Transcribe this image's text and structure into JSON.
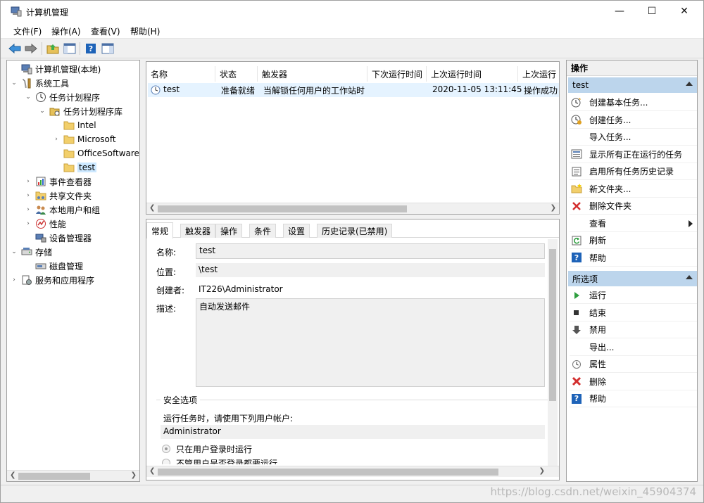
{
  "window": {
    "title": "计算机管理",
    "controls": {
      "minimize": "—",
      "maximize": "☐",
      "close": "✕"
    }
  },
  "menubar": [
    "文件(F)",
    "操作(A)",
    "查看(V)",
    "帮助(H)"
  ],
  "tree": [
    {
      "label": "计算机管理(本地)",
      "expander": "",
      "icon": "computer-management-icon"
    },
    {
      "label": "系统工具",
      "expander": "⌄",
      "icon": "system-tools-icon"
    },
    {
      "label": "任务计划程序",
      "expander": "⌄",
      "icon": "task-scheduler-icon"
    },
    {
      "label": "任务计划程序库",
      "expander": "⌄",
      "icon": "folder-open-icon"
    },
    {
      "label": "Intel",
      "expander": "",
      "icon": "folder-icon"
    },
    {
      "label": "Microsoft",
      "expander": "›",
      "icon": "folder-icon"
    },
    {
      "label": "OfficeSoftware",
      "expander": "",
      "icon": "folder-icon"
    },
    {
      "label": "test",
      "expander": "",
      "icon": "folder-icon"
    },
    {
      "label": "事件查看器",
      "expander": "›",
      "icon": "event-viewer-icon"
    },
    {
      "label": "共享文件夹",
      "expander": "›",
      "icon": "shared-folder-icon"
    },
    {
      "label": "本地用户和组",
      "expander": "›",
      "icon": "users-icon"
    },
    {
      "label": "性能",
      "expander": "›",
      "icon": "performance-icon"
    },
    {
      "label": "设备管理器",
      "expander": "",
      "icon": "device-manager-icon"
    },
    {
      "label": "存储",
      "expander": "⌄",
      "icon": "storage-icon"
    },
    {
      "label": "磁盘管理",
      "expander": "",
      "icon": "disk-management-icon"
    },
    {
      "label": "服务和应用程序",
      "expander": "›",
      "icon": "services-icon"
    }
  ],
  "task_list": {
    "columns": [
      "名称",
      "状态",
      "触发器",
      "下次运行时间",
      "上次运行时间",
      "上次运行"
    ],
    "rows": [
      {
        "name": "test",
        "status": "准备就绪",
        "trigger": "当解锁任何用户的工作站时",
        "next_run": "",
        "last_run": "2020-11-05 13:11:45",
        "last_result": "操作成功"
      }
    ]
  },
  "detail": {
    "tabs": [
      "常规",
      "触发器",
      "操作",
      "条件",
      "设置",
      "历史记录(已禁用)"
    ],
    "fields": {
      "name_label": "名称:",
      "name_value": "test",
      "location_label": "位置:",
      "location_value": "\\test",
      "author_label": "创建者:",
      "author_value": "IT226\\Administrator",
      "desc_label": "描述:",
      "desc_value": "自动发送邮件"
    },
    "security": {
      "title": "安全选项",
      "run_as_prompt": "运行任务时，请使用下列用户帐户:",
      "account": "Administrator",
      "option1": "只在用户登录时运行",
      "option2": "不管用户是否登录都要运行"
    }
  },
  "actions": {
    "header": "操作",
    "section_test": "test",
    "test_items": [
      {
        "label": "创建基本任务...",
        "icon": "create-basic-task-icon"
      },
      {
        "label": "创建任务...",
        "icon": "create-task-icon"
      },
      {
        "label": "导入任务...",
        "icon": ""
      },
      {
        "label": "显示所有正在运行的任务",
        "icon": "running-tasks-icon"
      },
      {
        "label": "启用所有任务历史记录",
        "icon": "history-icon"
      },
      {
        "label": "新文件夹...",
        "icon": "new-folder-icon"
      },
      {
        "label": "删除文件夹",
        "icon": "delete-folder-icon"
      },
      {
        "label": "查看",
        "icon": ""
      },
      {
        "label": "刷新",
        "icon": "refresh-icon"
      },
      {
        "label": "帮助",
        "icon": "help-icon"
      }
    ],
    "section_selected": "所选项",
    "selected_items": [
      {
        "label": "运行",
        "icon": "run-icon"
      },
      {
        "label": "结束",
        "icon": "stop-icon"
      },
      {
        "label": "禁用",
        "icon": "disable-icon"
      },
      {
        "label": "导出...",
        "icon": ""
      },
      {
        "label": "属性",
        "icon": "properties-icon"
      },
      {
        "label": "删除",
        "icon": "delete-icon"
      },
      {
        "label": "帮助",
        "icon": "help-icon"
      }
    ]
  },
  "watermark": "https://blog.csdn.net/weixin_45904374",
  "colors": {
    "selection": "#cce8ff",
    "row_highlight": "#e5f3ff",
    "section_header": "#bcd5ec",
    "help_blue": "#1e63b8",
    "delete_red": "#d32f2f",
    "run_green": "#2e9e3f"
  }
}
